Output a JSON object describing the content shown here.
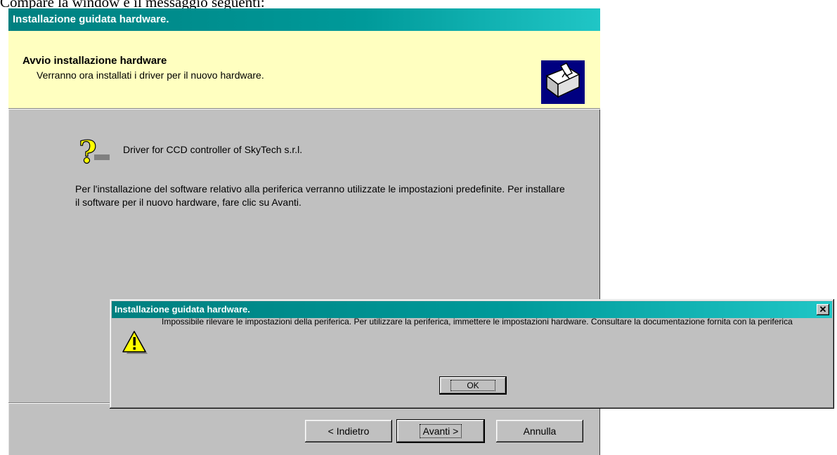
{
  "page_caption": "Compare la window e il messaggio seguenti:",
  "wizard": {
    "title": "Installazione guidata hardware.",
    "header_title": "Avvio installazione hardware",
    "header_subtitle": "Verranno ora installati i driver per il nuovo hardware.",
    "device_name": "Driver for CCD controller of SkyTech s.r.l.",
    "body_text": "Per l'installazione del software relativo alla periferica verranno utilizzate le impostazioni predefinite. Per installare il software per il nuovo hardware, fare clic su Avanti.",
    "buttons": {
      "back_label": "Indietro",
      "next_label": "Avanti",
      "cancel_label": "Annulla"
    }
  },
  "dialog": {
    "title": "Installazione guidata hardware.",
    "message": "Impossibile rilevare le impostazioni della periferica.  Per utilizzare la periferica, immettere le impostazioni hardware.  Consultare la documentazione fornita con la periferica",
    "ok_label": "OK",
    "close_glyph": "✕"
  },
  "colors": {
    "titlebar": "#008080",
    "header_bg": "#ffffc0",
    "face": "#c0c0c0"
  },
  "icons": [
    "hardware-install-icon",
    "question-icon",
    "warning-icon",
    "close-icon"
  ]
}
